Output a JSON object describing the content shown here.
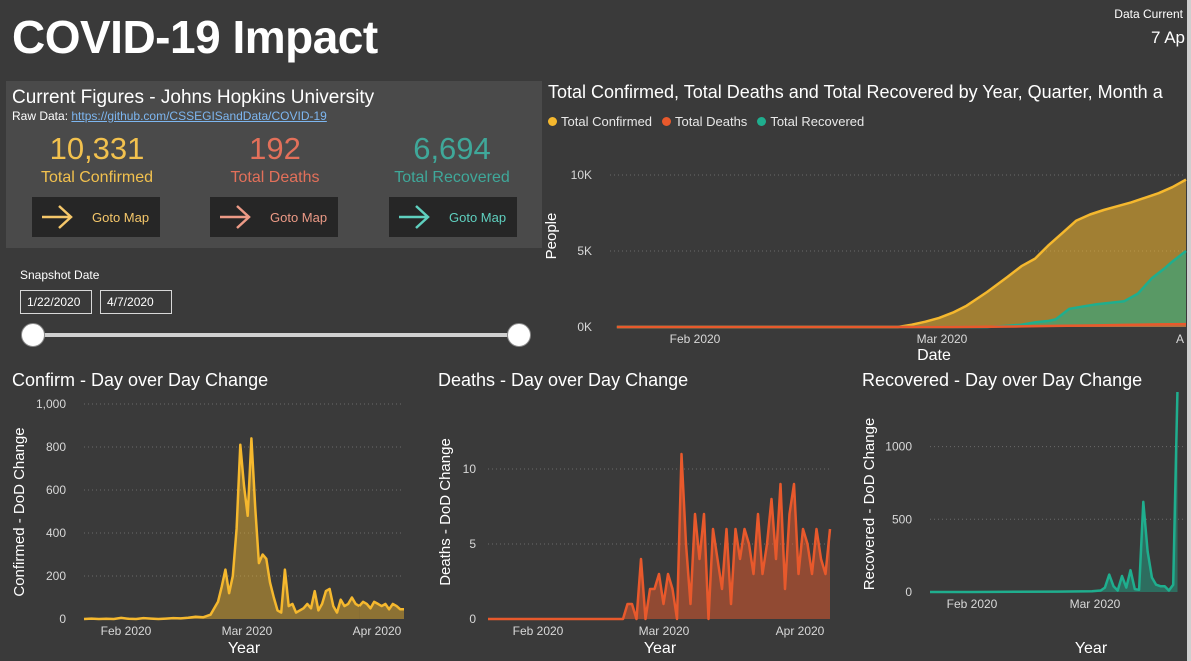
{
  "header": {
    "title": "COVID-19 Impact",
    "as_of_label": "Data Current",
    "as_of_date": "7 Ap"
  },
  "figures": {
    "title": "Current Figures - Johns Hopkins University",
    "raw_label": "Raw Data:",
    "raw_link": "https://github.com/CSSEGISandData/COVID-19",
    "goto_label": "Goto Map",
    "kpis": [
      {
        "value": "10,331",
        "label": "Total Confirmed",
        "color": "#f2c14e"
      },
      {
        "value": "192",
        "label": "Total Deaths",
        "color": "#e3705a"
      },
      {
        "value": "6,694",
        "label": "Total Recovered",
        "color": "#3fa89a"
      }
    ]
  },
  "snapshot": {
    "label": "Snapshot Date",
    "start": "1/22/2020",
    "end": "4/7/2020"
  },
  "colors": {
    "confirmed": "#f5b82e",
    "deaths": "#e8592c",
    "recovered": "#1fae8e",
    "grid": "#6a6a6a",
    "tick": "#d8d8d8"
  },
  "chart_data": [
    {
      "id": "main",
      "type": "area",
      "title": "Total Confirmed, Total Deaths and Total Recovered by Year, Quarter, Month a",
      "xlabel": "Date",
      "ylabel": "People",
      "y_ticks": [
        "10K",
        "5K",
        "0K"
      ],
      "x_ticks": [
        "Feb 2020",
        "Mar 2020",
        "A"
      ],
      "legend": "top-left",
      "ylim": [
        0,
        10000
      ],
      "series": [
        {
          "name": "Total Confirmed",
          "x": [
            1,
            42,
            44,
            46,
            48,
            50,
            52,
            55,
            58,
            60,
            62,
            64,
            66,
            68,
            70,
            72,
            74,
            76,
            78,
            80,
            82,
            84
          ],
          "y": [
            0,
            0,
            150,
            350,
            600,
            950,
            1400,
            2300,
            3300,
            4000,
            4500,
            5400,
            6200,
            7000,
            7400,
            7700,
            7950,
            8200,
            8500,
            8800,
            9200,
            9700
          ]
        },
        {
          "name": "Total Deaths",
          "x": [
            1,
            50,
            55,
            60,
            65,
            70,
            75,
            80,
            84
          ],
          "y": [
            0,
            0,
            20,
            40,
            70,
            100,
            140,
            170,
            192
          ]
        },
        {
          "name": "Total Recovered",
          "x": [
            1,
            55,
            58,
            60,
            62,
            64,
            65,
            67,
            69,
            71,
            73,
            75,
            77,
            79,
            81,
            82,
            84
          ],
          "y": [
            0,
            0,
            80,
            150,
            300,
            400,
            500,
            1200,
            1350,
            1500,
            1600,
            1700,
            2200,
            3200,
            3900,
            4300,
            5000
          ]
        }
      ]
    },
    {
      "id": "confirm",
      "type": "area",
      "title": "Confirm - Day over Day Change",
      "xlabel": "Year",
      "ylabel": "Confirmed - DoD Change",
      "ylim": [
        0,
        1000
      ],
      "y_ticks": [
        "1,000",
        "800",
        "600",
        "400",
        "200",
        "0"
      ],
      "x_ticks": [
        "Feb 2020",
        "Mar 2020",
        "Apr 2020"
      ],
      "series": [
        {
          "name": "Confirmed - DoD Change",
          "x": [
            0,
            2,
            4,
            6,
            8,
            10,
            12,
            14,
            16,
            18,
            20,
            22,
            24,
            26,
            28,
            30,
            32,
            34,
            36,
            37,
            38,
            39,
            40,
            41,
            42,
            43,
            44,
            45,
            46,
            47,
            48,
            49,
            50,
            51,
            52,
            53,
            54,
            55,
            56,
            57,
            58,
            59,
            60,
            61,
            62,
            63,
            64,
            65,
            66,
            67,
            68,
            69,
            70,
            71,
            72,
            73,
            74
          ],
          "y": [
            0,
            2,
            0,
            1,
            0,
            5,
            1,
            0,
            4,
            2,
            0,
            2,
            4,
            3,
            6,
            10,
            8,
            20,
            80,
            150,
            230,
            120,
            200,
            420,
            810,
            620,
            480,
            840,
            520,
            260,
            300,
            280,
            170,
            100,
            40,
            30,
            230,
            60,
            70,
            30,
            40,
            50,
            70,
            50,
            130,
            40,
            70,
            130,
            140,
            60,
            30,
            90,
            60,
            70,
            100,
            70,
            60
          ]
        },
        {
          "name": "Confirmed - DoD Change",
          "x": [
            74,
            75,
            76,
            77,
            78,
            79,
            80,
            81,
            82,
            83,
            84,
            85,
            86
          ],
          "y": [
            60,
            80,
            70,
            50,
            80,
            70,
            60,
            70,
            45,
            70,
            60,
            45,
            45
          ]
        }
      ]
    },
    {
      "id": "deaths",
      "type": "area",
      "title": "Deaths - Day over Day Change",
      "xlabel": "Year",
      "ylabel": "Deaths - DoD Change",
      "ylim": [
        0,
        12
      ],
      "y_ticks": [
        "10",
        "5",
        "0"
      ],
      "x_ticks": [
        "Feb 2020",
        "Mar 2020",
        "Apr 2020"
      ],
      "series": [
        {
          "name": "Deaths - DoD Change",
          "x": [
            0,
            30,
            31,
            32,
            33,
            34,
            35,
            36,
            37,
            38,
            39,
            40,
            41,
            42,
            43,
            44,
            45,
            46,
            47,
            48,
            49,
            50,
            51,
            52,
            53,
            54,
            55,
            56,
            57,
            58,
            59,
            60,
            61,
            62,
            63,
            64,
            65,
            66,
            67,
            68,
            69,
            70,
            71,
            72,
            73,
            74,
            75,
            76
          ],
          "y": [
            0,
            0,
            1,
            1,
            0,
            4,
            0,
            2,
            2,
            3,
            1,
            3,
            2,
            0,
            11,
            5,
            1,
            7,
            4,
            7,
            0,
            6,
            4,
            2,
            6,
            1,
            6,
            4,
            6,
            5,
            3,
            7,
            3,
            5,
            8,
            4,
            9,
            2,
            7,
            9,
            3,
            6,
            5,
            3,
            6,
            4,
            3,
            6
          ]
        }
      ]
    },
    {
      "id": "recovered",
      "type": "area",
      "title": "Recovered - Day over Day Change",
      "xlabel": "Year",
      "ylabel": "Recovered - DoD Change",
      "ylim": [
        0,
        1300
      ],
      "y_ticks": [
        "1000",
        "500",
        "0"
      ],
      "x_ticks": [
        "Feb 2020",
        "Mar 2020"
      ],
      "series": [
        {
          "name": "Recovered - DoD Change",
          "x": [
            0,
            10,
            20,
            30,
            38,
            40,
            41,
            42,
            43,
            44,
            45,
            46,
            47,
            48,
            49,
            50,
            51,
            52,
            53,
            54,
            55,
            56,
            57,
            58
          ],
          "y": [
            0,
            0,
            2,
            3,
            5,
            10,
            30,
            120,
            40,
            10,
            110,
            30,
            150,
            20,
            15,
            620,
            280,
            100,
            50,
            40,
            40,
            10,
            50,
            1400
          ]
        }
      ]
    }
  ]
}
